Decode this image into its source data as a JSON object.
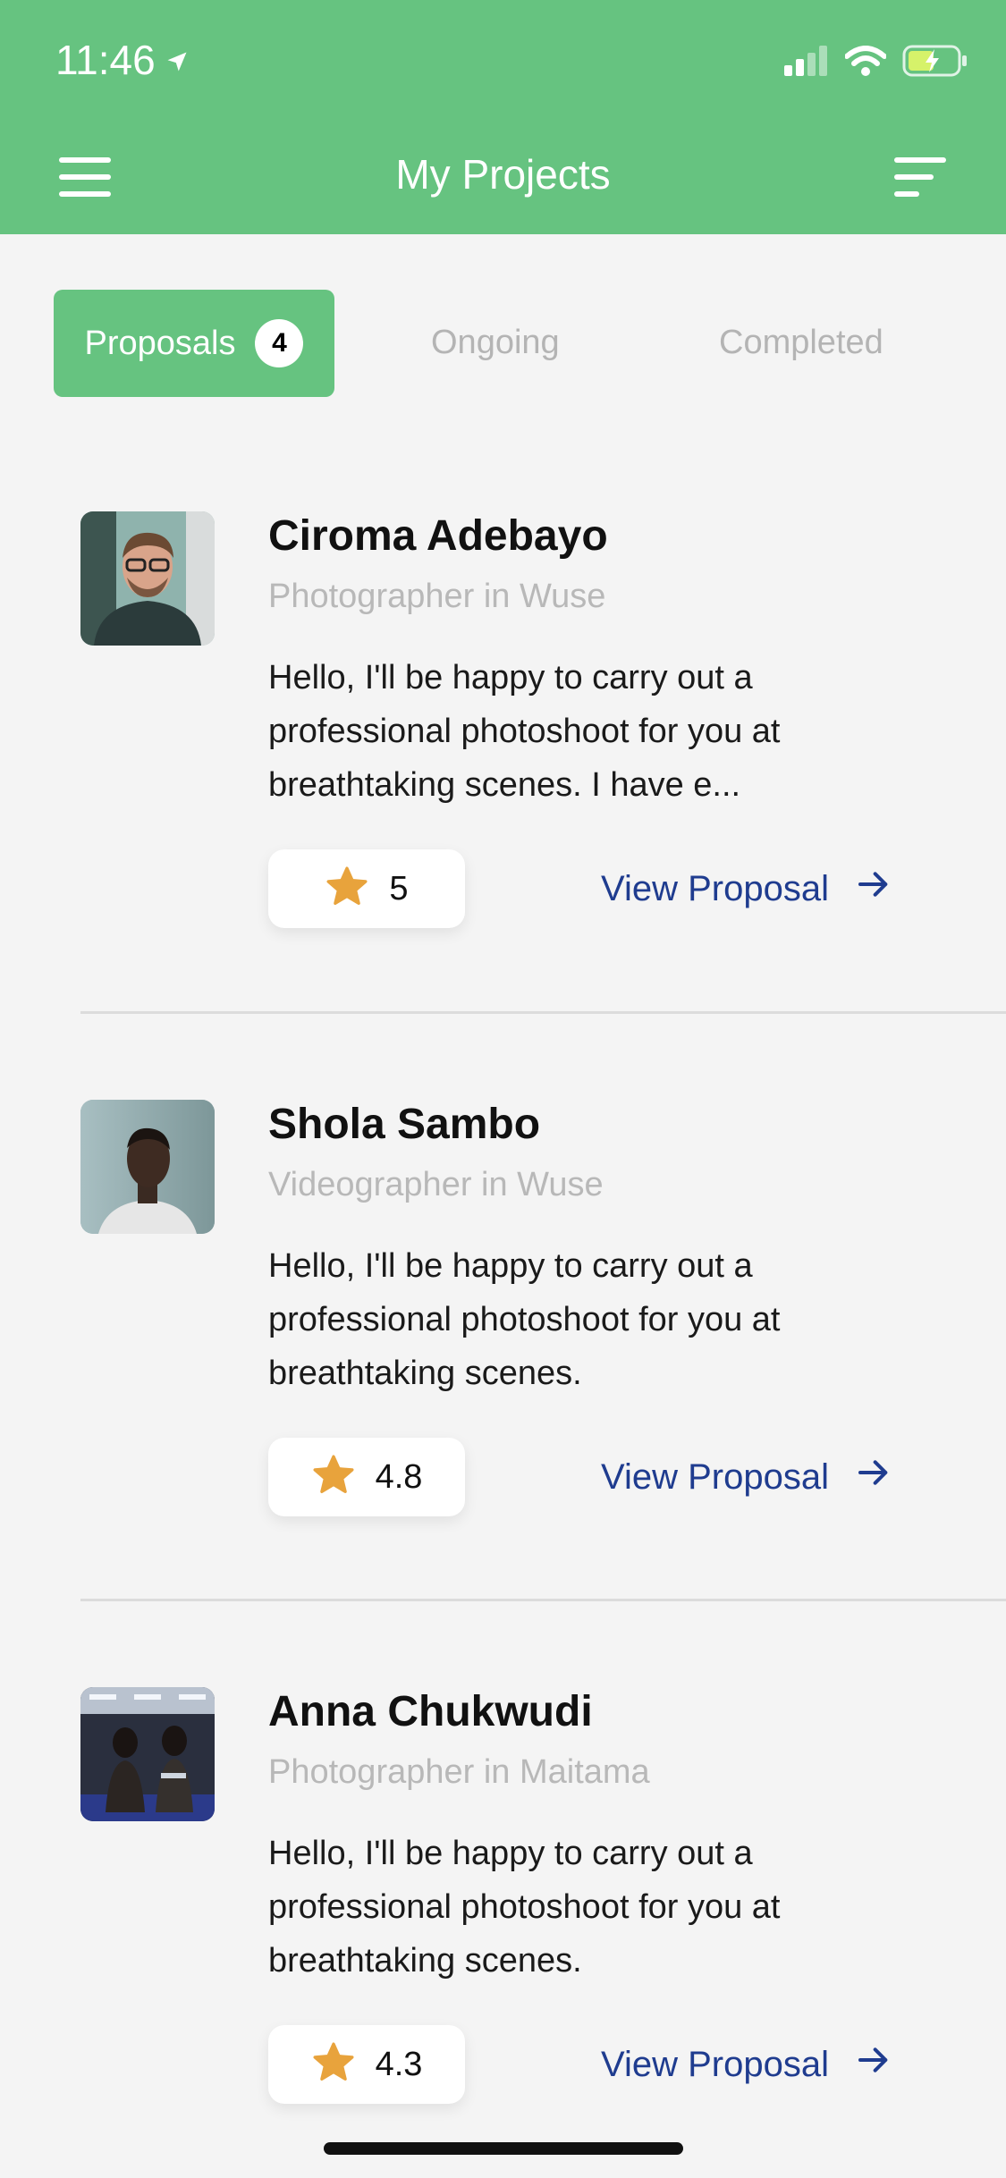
{
  "status_bar": {
    "time": "11:46"
  },
  "header": {
    "title": "My Projects",
    "menu_icon": "hamburger-menu-icon",
    "sort_icon": "sort-icon"
  },
  "tabs": [
    {
      "label": "Proposals",
      "badge": "4",
      "active": true
    },
    {
      "label": "Ongoing",
      "active": false
    },
    {
      "label": "Completed",
      "active": false
    }
  ],
  "proposals": [
    {
      "name": "Ciroma Adebayo",
      "subtitle": "Photographer in Wuse",
      "message": "Hello, I'll be happy to carry out a professional photoshoot for you at breathtaking scenes. I have e...",
      "rating": "5",
      "action_label": "View Proposal"
    },
    {
      "name": "Shola Sambo",
      "subtitle": "Videographer in Wuse",
      "message": "Hello, I'll be happy to carry out a professional photoshoot for you at breathtaking scenes.",
      "rating": "4.8",
      "action_label": "View Proposal"
    },
    {
      "name": "Anna Chukwudi",
      "subtitle": "Photographer in Maitama",
      "message": "Hello, I'll be happy to carry out a professional photoshoot for you at breathtaking scenes.",
      "rating": "4.3",
      "action_label": "View Proposal"
    }
  ],
  "colors": {
    "header_green": "#66c380",
    "link_blue": "#1f3c8f",
    "star_orange": "#e8a33c"
  }
}
